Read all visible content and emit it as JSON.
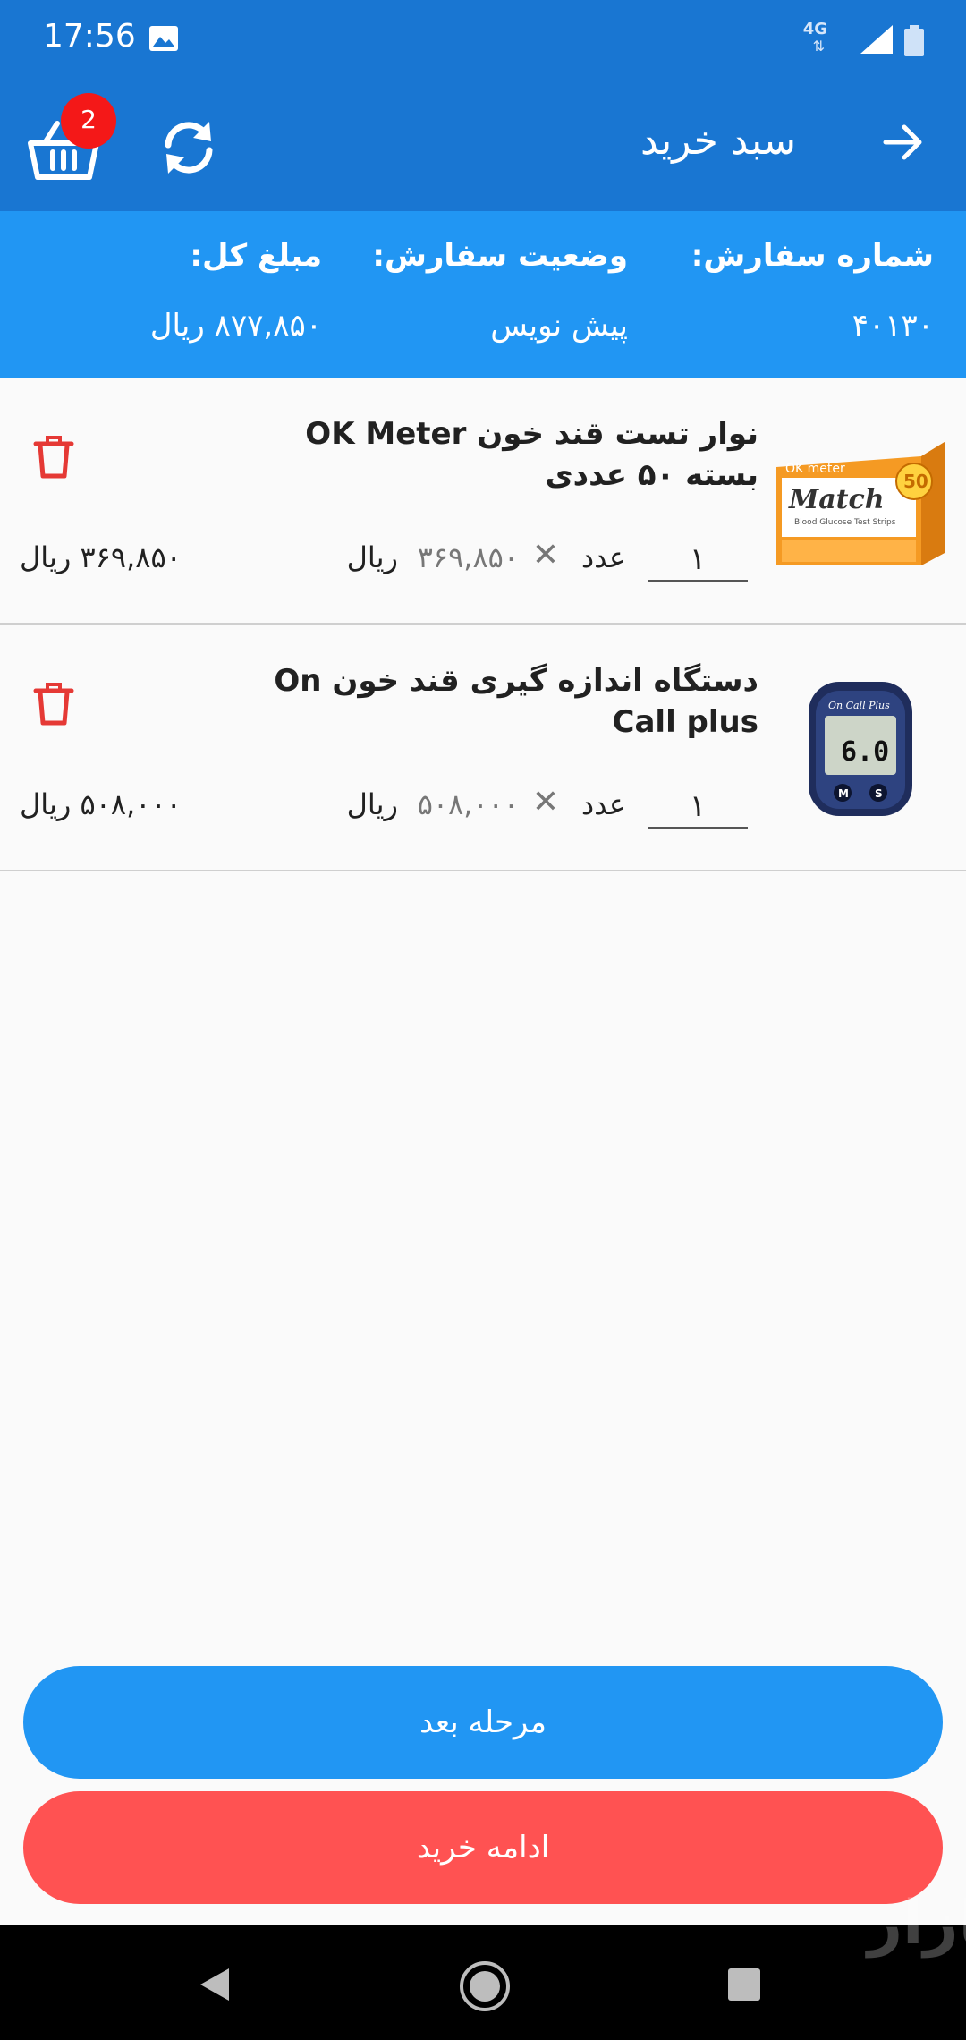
{
  "status_bar": {
    "time": "17:56",
    "network": "4G",
    "network_arrows": "⇅",
    "icons": [
      "image-icon",
      "signal-icon",
      "battery-icon"
    ]
  },
  "app_bar": {
    "title": "سبد خرید",
    "cart_badge_count": "2",
    "icons": [
      "back-arrow-icon",
      "refresh-icon",
      "shopping-basket-icon"
    ]
  },
  "order_info": {
    "number_label": "شماره سفارش:",
    "number_value": "۴۰۱۳۰",
    "status_label": "وضعیت سفارش:",
    "status_value": "پیش نویس",
    "total_label": "مبلغ کل:",
    "total_value": "۸۷۷,۸۵۰ ریال"
  },
  "cart": {
    "items": [
      {
        "title": "نوار تست قند خون OK Meter بسته ۵۰ عددی",
        "quantity": "۱",
        "unit_label": "عدد",
        "times": "✕",
        "unit_price": "۳۶۹,۸۵۰",
        "currency": "ریال",
        "line_total": "۳۶۹,۸۵۰ ریال",
        "thumb_text_brand": "Match",
        "thumb_text_count": "50",
        "thumb_text_sub": "Blood Glucose Test Strips",
        "thumb_text_logo": "OK meter"
      },
      {
        "title": "دستگاه اندازه گیری قند خون On Call plus",
        "quantity": "۱",
        "unit_label": "عدد",
        "times": "✕",
        "unit_price": "۵۰۸,۰۰۰",
        "currency": "ریال",
        "line_total": "۵۰۸,۰۰۰ ریال",
        "thumb_text_brand": "On Call Plus",
        "thumb_text_reading": "6.0",
        "thumb_text_btn1": "M",
        "thumb_text_btn2": "S"
      }
    ]
  },
  "buttons": {
    "next": "مرحله بعد",
    "continue_shopping": "ادامه خرید"
  },
  "colors": {
    "app_bar": "#1976d2",
    "order_panel": "#2196f3",
    "next_button": "#2196f3",
    "continue_button": "#ff5252",
    "badge": "#f41818",
    "trash": "#e53935"
  },
  "nav_bar": {
    "icons": [
      "nav-back-icon",
      "nav-home-icon",
      "nav-recents-icon"
    ]
  },
  "watermark": "بازار"
}
